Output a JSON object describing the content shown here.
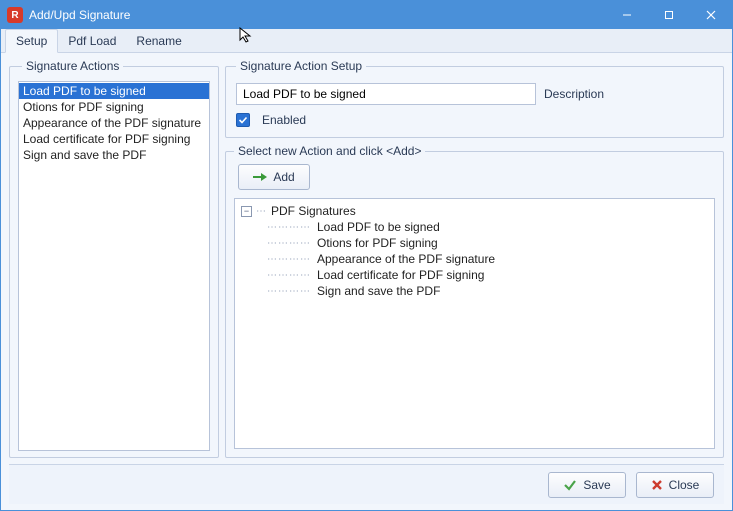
{
  "window": {
    "title": "Add/Upd Signature",
    "app_icon_letter": "R"
  },
  "tabs": [
    {
      "label": "Setup",
      "active": true
    },
    {
      "label": "Pdf Load",
      "active": false
    },
    {
      "label": "Rename",
      "active": false
    }
  ],
  "left_panel": {
    "legend": "Signature Actions",
    "items": [
      "Load PDF to be signed",
      "Otions for PDF signing",
      "Appearance of the PDF signature",
      "Load certificate for PDF signing",
      "Sign and save the PDF"
    ],
    "selected_index": 0
  },
  "setup": {
    "legend": "Signature Action Setup",
    "name_value": "Load PDF to be signed",
    "description_label": "Description",
    "enabled_label": "Enabled",
    "enabled_checked": true
  },
  "action_select": {
    "legend": "Select new Action  and click  <Add>",
    "add_label": "Add",
    "tree_root": "PDF Signatures",
    "tree_items": [
      "Load PDF to be signed",
      "Otions for PDF signing",
      "Appearance of the PDF signature",
      "Load certificate for PDF signing",
      "Sign and save the PDF"
    ]
  },
  "footer": {
    "save_label": "Save",
    "close_label": "Close"
  }
}
